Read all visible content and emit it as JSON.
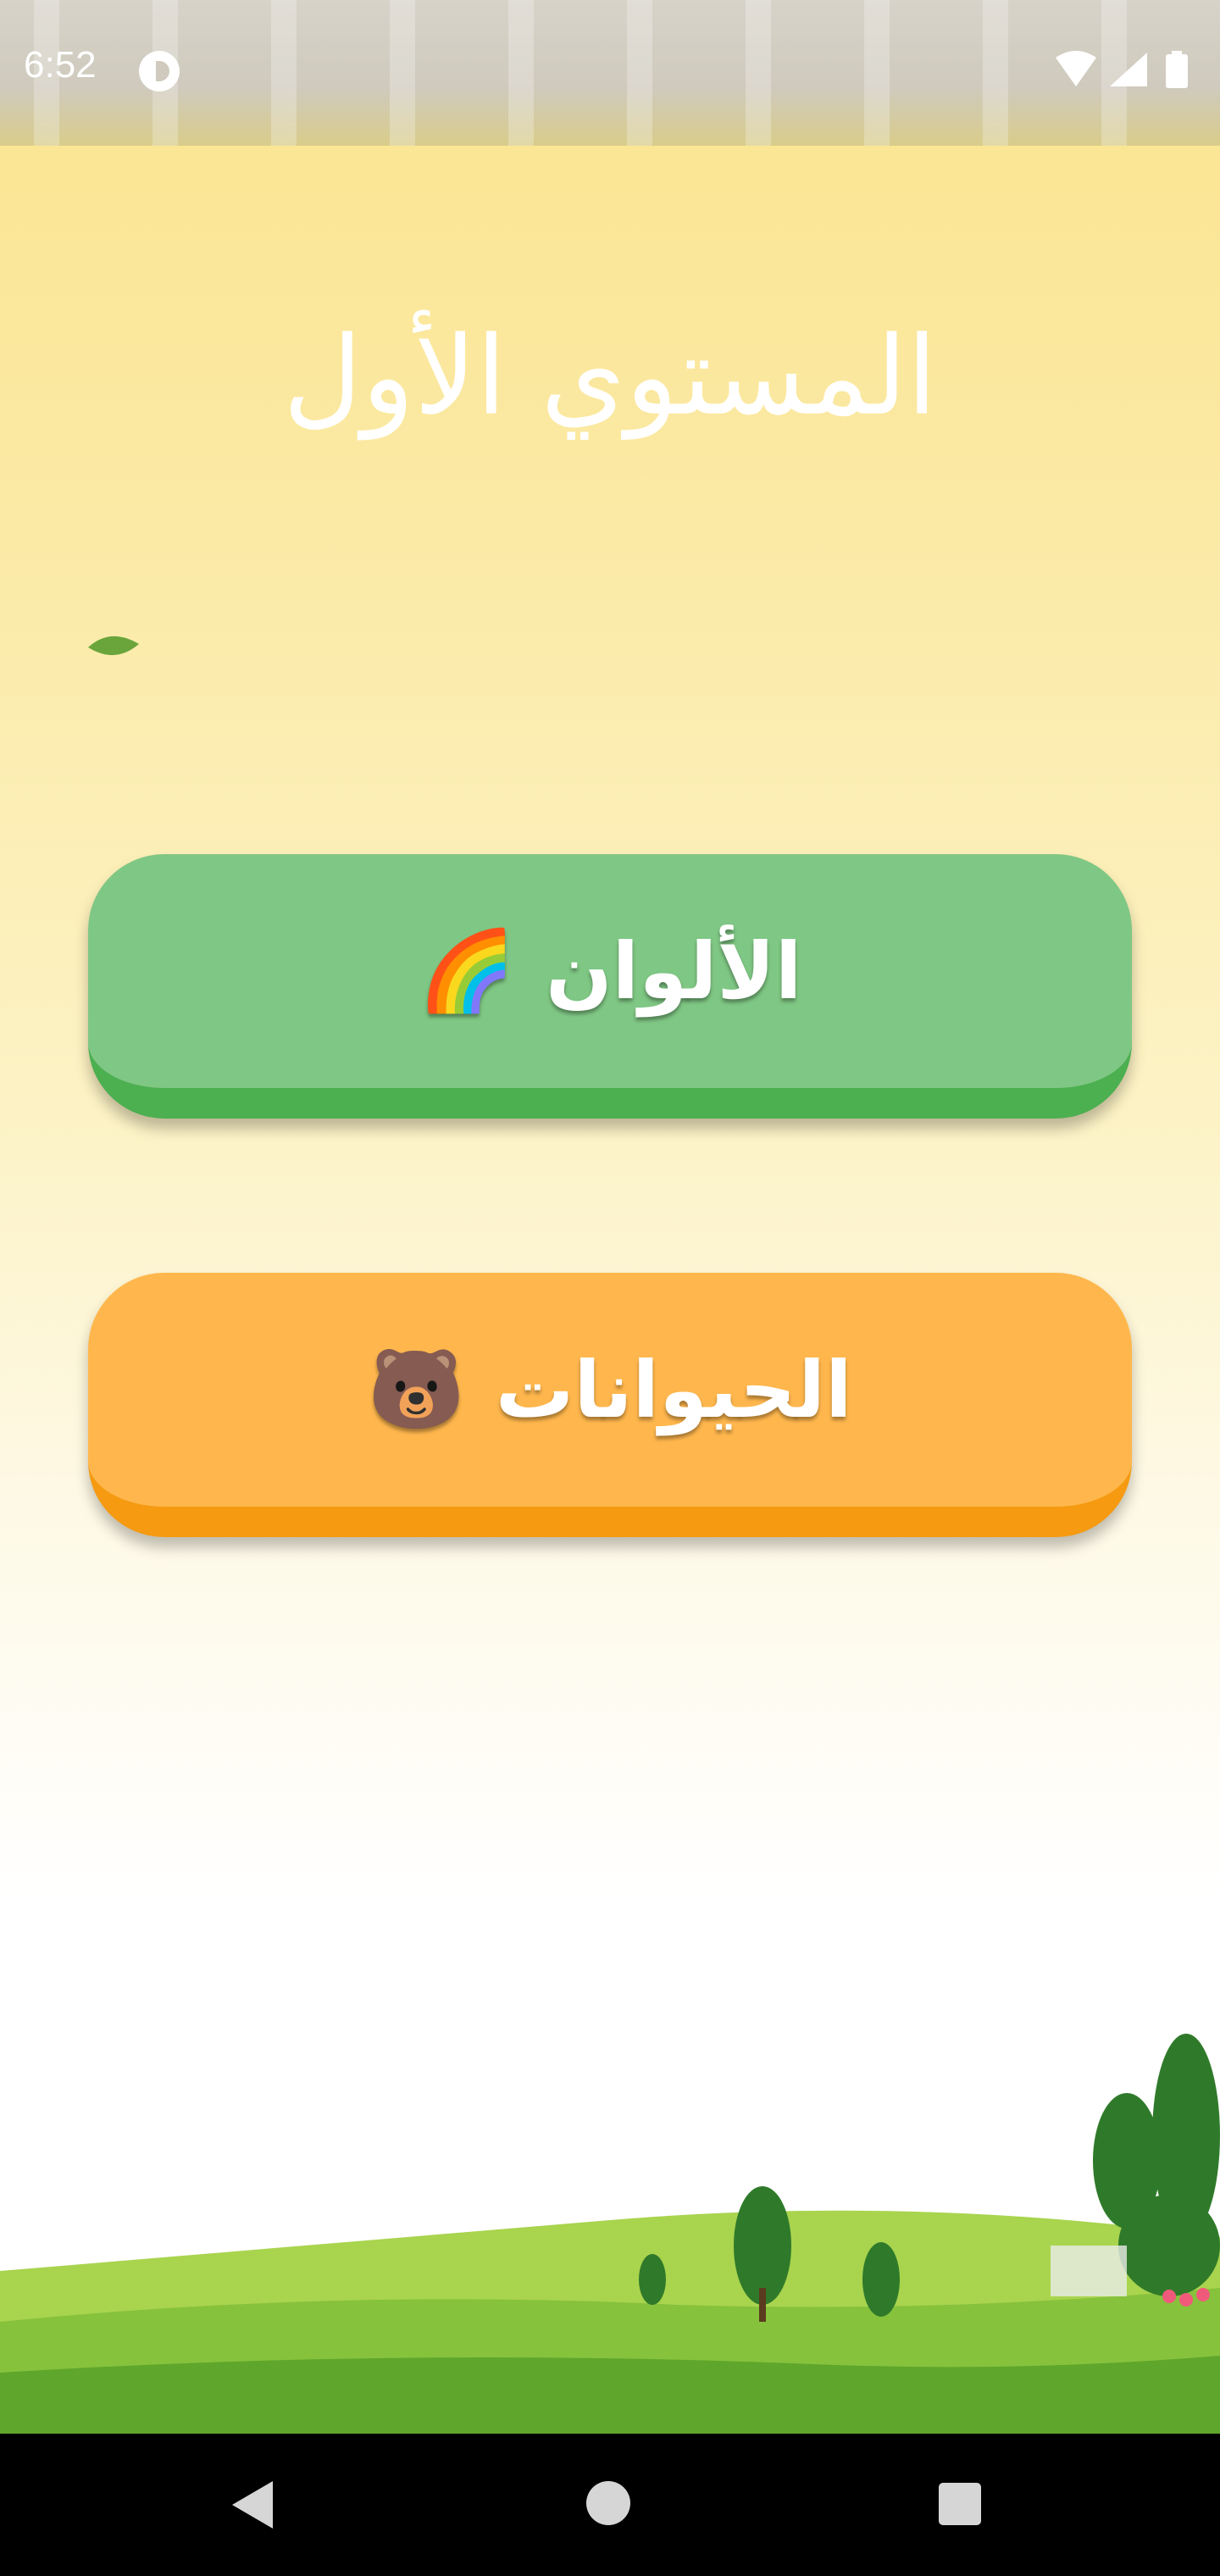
{
  "status_bar": {
    "time": "6:52",
    "icons": [
      "app-indicator-icon",
      "wifi-icon",
      "signal-icon",
      "battery-icon"
    ]
  },
  "screen": {
    "title": "المستوي الأول"
  },
  "buttons": [
    {
      "label": "الألوان",
      "emoji": "🌈",
      "color": "#7fc784",
      "shade": "#4caf50"
    },
    {
      "label": "الحيوانات",
      "emoji": "🐻",
      "color": "#ffb74d",
      "shade": "#f59a11"
    }
  ],
  "nav_bar": {
    "icons": [
      "back-icon",
      "home-icon",
      "recents-icon"
    ]
  }
}
